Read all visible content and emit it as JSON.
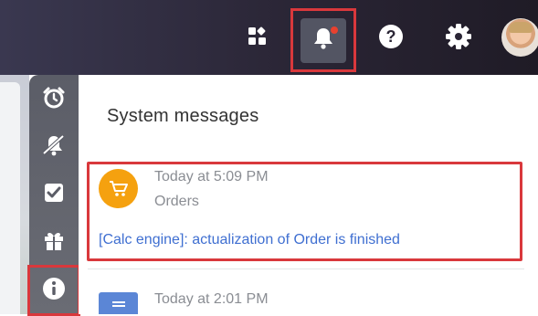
{
  "header": {
    "apps_icon": "apps-grid-icon",
    "notifications_icon": "bell-icon",
    "notification_dot_color": "#e8412f",
    "help_icon": "help-icon",
    "settings_icon": "gear-icon",
    "avatar": "user-avatar"
  },
  "sidebar": {
    "items": [
      {
        "icon": "alarm-clock-icon"
      },
      {
        "icon": "bell-off-icon"
      },
      {
        "icon": "checkbox-icon"
      },
      {
        "icon": "gift-icon"
      },
      {
        "icon": "info-icon"
      }
    ]
  },
  "panel": {
    "title": "System messages",
    "messages": [
      {
        "time": "Today at 5:09 PM",
        "source": "Orders",
        "text": "[Calc engine]: actualization of Order is finished",
        "icon": "cart-icon",
        "icon_color": "#f5a10f"
      },
      {
        "time": "Today at 2:01 PM",
        "icon": "list-icon",
        "icon_color": "#5b86d6"
      }
    ]
  },
  "colors": {
    "highlight": "#d9383c",
    "link": "#3f6fd1"
  }
}
